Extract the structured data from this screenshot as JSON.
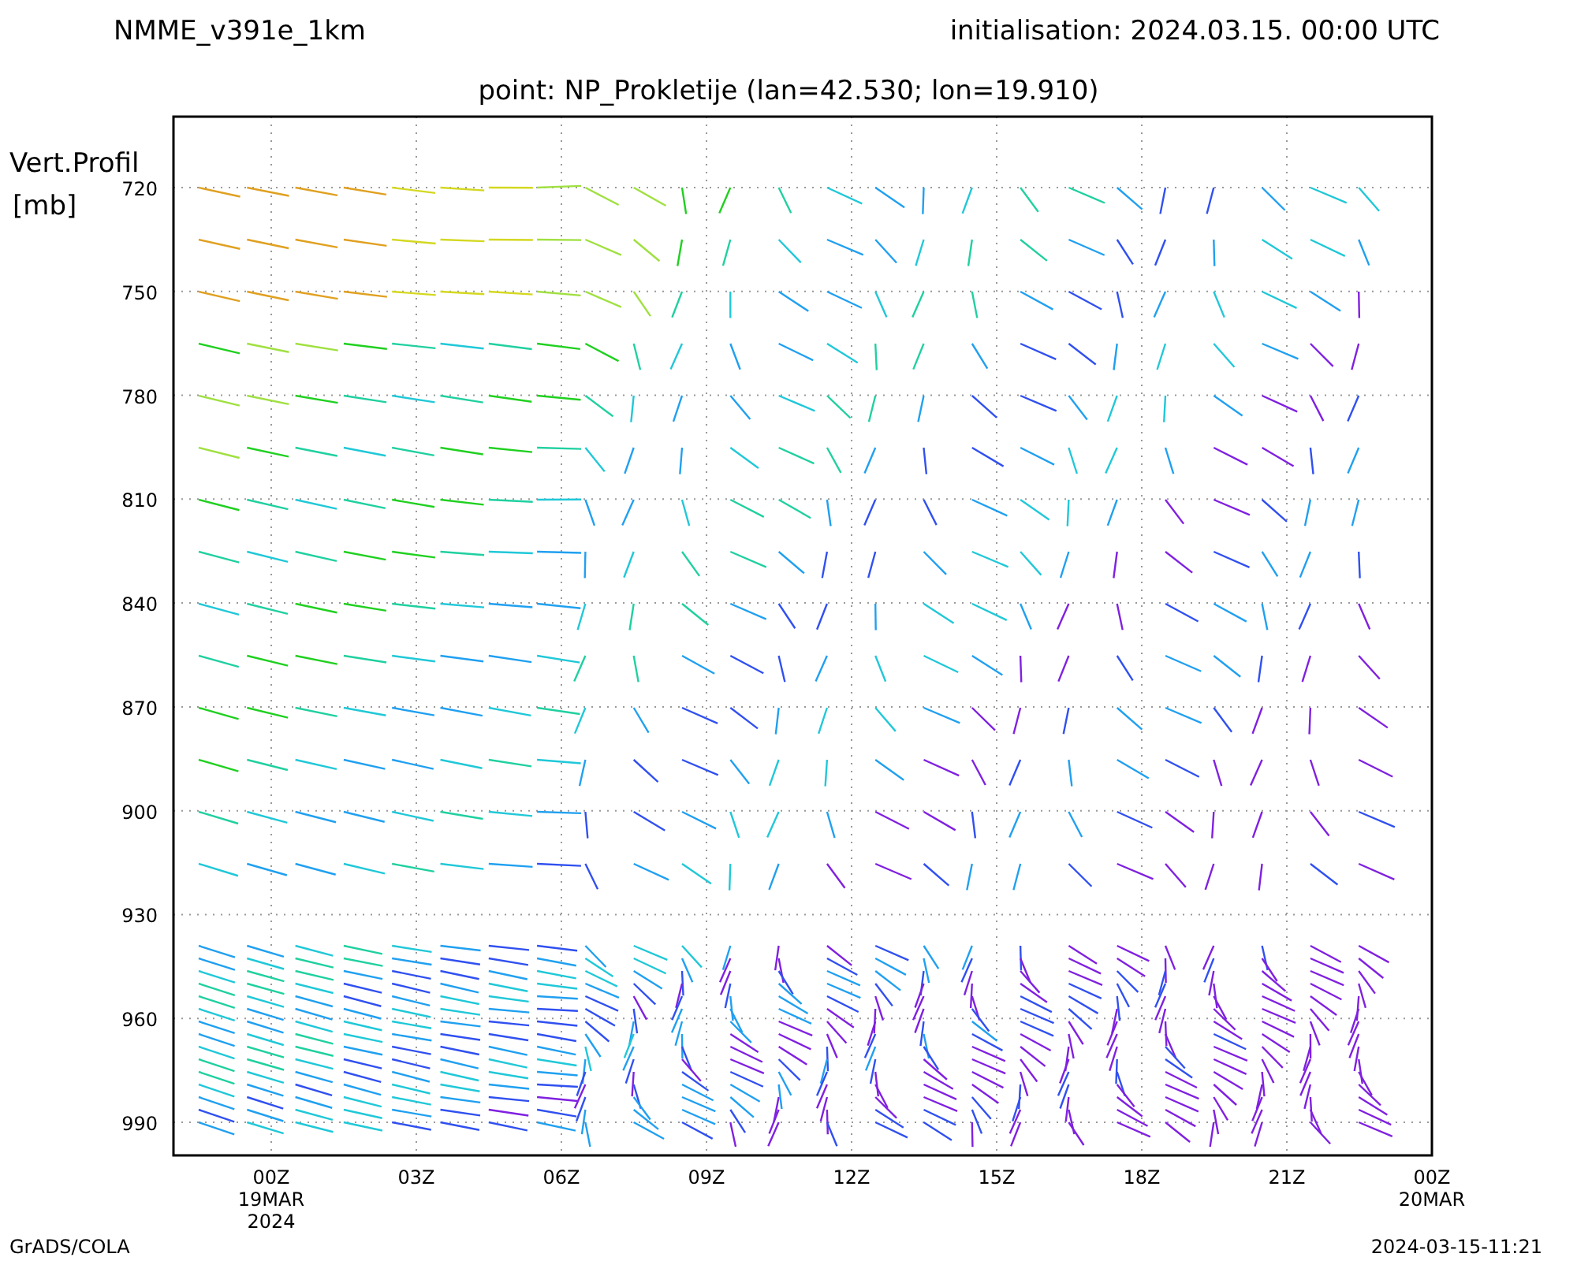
{
  "header": {
    "model": "NMME_v391e_1km",
    "initialisation": "initialisation: 2024.03.15. 00:00 UTC",
    "point": "point: NP_Prokletije (lan=42.530; lon=19.910)"
  },
  "y_axis": {
    "title": [
      "Vert.Profil",
      "[mb]"
    ],
    "ticks": [
      "720",
      "750",
      "780",
      "810",
      "840",
      "870",
      "900",
      "930",
      "960",
      "990"
    ]
  },
  "x_axis": {
    "ticks": [
      {
        "lines": [
          "00Z",
          "19MAR",
          "2024"
        ]
      },
      {
        "lines": [
          "03Z"
        ]
      },
      {
        "lines": [
          "06Z"
        ]
      },
      {
        "lines": [
          "09Z"
        ]
      },
      {
        "lines": [
          "12Z"
        ]
      },
      {
        "lines": [
          "15Z"
        ]
      },
      {
        "lines": [
          "18Z"
        ]
      },
      {
        "lines": [
          "21Z"
        ]
      },
      {
        "lines": [
          "00Z",
          "20MAR"
        ]
      }
    ]
  },
  "footer": {
    "left": "GrADS/COLA",
    "right": "2024-03-15-11:21"
  }
}
